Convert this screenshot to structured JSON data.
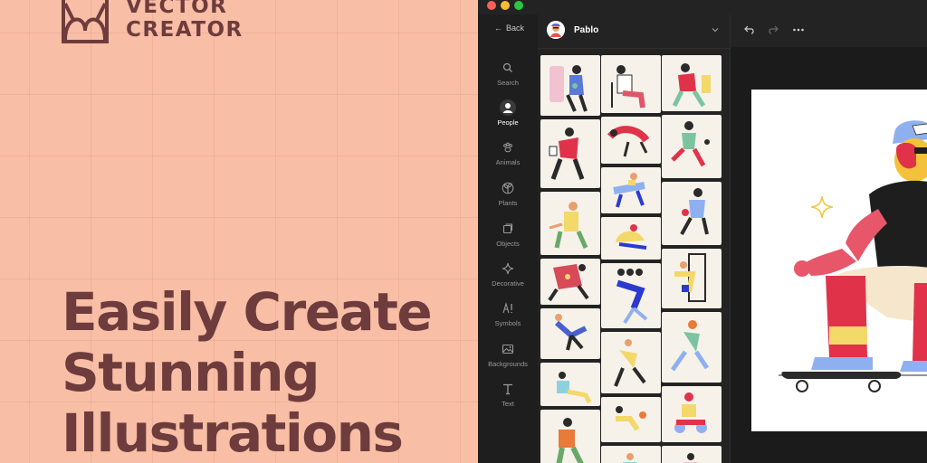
{
  "brand": {
    "line1": "VECTOR",
    "line2": "CREATOR",
    "mark": "vector-creator-logo"
  },
  "headline": {
    "line1": "Easily Create",
    "line2": "Stunning",
    "line3": "Illustrations"
  },
  "window": {
    "controls": [
      "close",
      "minimize",
      "maximize"
    ]
  },
  "sidebar": {
    "back_label": "Back",
    "items": [
      {
        "label": "Search",
        "icon": "search-icon"
      },
      {
        "label": "People",
        "icon": "person-icon",
        "active": true
      },
      {
        "label": "Animals",
        "icon": "paw-icon"
      },
      {
        "label": "Plants",
        "icon": "plant-icon"
      },
      {
        "label": "Objects",
        "icon": "objects-icon"
      },
      {
        "label": "Decorative",
        "icon": "sparkle-icon"
      },
      {
        "label": "Symbols",
        "icon": "symbols-icon"
      },
      {
        "label": "Backgrounds",
        "icon": "image-icon"
      },
      {
        "label": "Text",
        "icon": "text-icon"
      }
    ]
  },
  "panel": {
    "pack_name": "Pablo"
  },
  "toolbar": {
    "tools": [
      "undo-icon",
      "redo-icon",
      "more-icon"
    ]
  },
  "colors": {
    "promo_bg": "#f8bea6",
    "headline": "#6e3c3c",
    "app_bg": "#232323",
    "tile_bg": "#f6f2ea"
  }
}
